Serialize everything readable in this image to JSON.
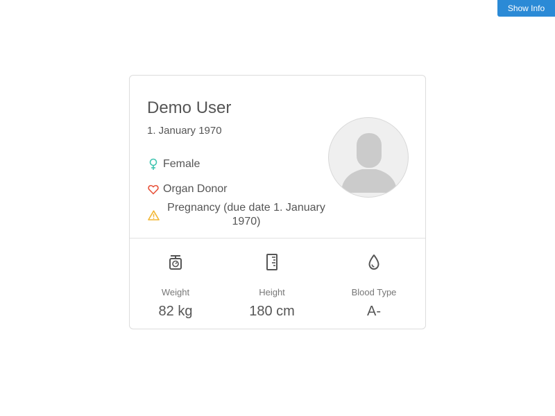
{
  "header": {
    "show_info_label": "Show Info"
  },
  "profile": {
    "name": "Demo User",
    "dob": "1. January 1970",
    "gender": "Female",
    "organ_donor": "Organ Donor",
    "pregnancy": "Pregnancy (due date 1. January 1970)",
    "icons": {
      "gender": "female-icon",
      "organ_donor": "heart-icon",
      "pregnancy": "warning-icon",
      "avatar": "user-silhouette-icon"
    }
  },
  "stats": [
    {
      "icon": "scale-icon",
      "label": "Weight",
      "value": "82 kg"
    },
    {
      "icon": "ruler-icon",
      "label": "Height",
      "value": "180 cm"
    },
    {
      "icon": "drop-icon",
      "label": "Blood Type",
      "value": "A-"
    }
  ],
  "colors": {
    "accent": "#2b8ad6",
    "female": "#3fc4b0",
    "heart": "#e8543c",
    "warning": "#f2b632"
  }
}
